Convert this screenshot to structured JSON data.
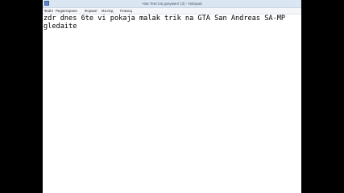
{
  "window": {
    "title": "Нов Текстов документ (3) - Notepad"
  },
  "menubar": {
    "items": [
      "Файл",
      "Редактиране",
      "Формат",
      "Изглед",
      "Помощ"
    ]
  },
  "editor": {
    "lines": [
      "zdr dnes 6te vi pokaja malak trik na GTA San Andreas SA-MP",
      "gledaite"
    ]
  },
  "icons": {
    "app": "notepad-icon"
  },
  "colors": {
    "titlebar": "#dbe6f3",
    "menubar": "#f4f6f9",
    "editor_bg": "#ffffff",
    "text": "#000000",
    "letterbox": "#000000"
  }
}
